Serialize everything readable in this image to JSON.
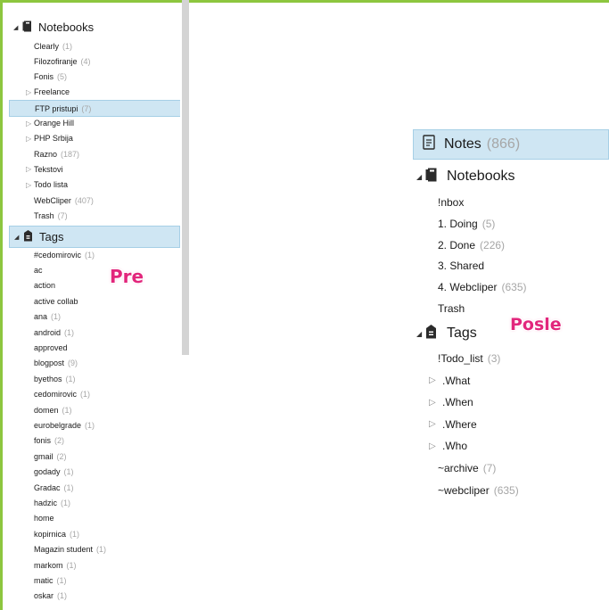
{
  "colors": {
    "accent_border": "#8dc63f",
    "selection": "#cfe6f3",
    "count": "#a6a6a6",
    "overlay_label": "#e2267c"
  },
  "before": {
    "notebooks_label": "Notebooks",
    "notebooks": [
      {
        "label": "Clearly",
        "count": "(1)",
        "expandable": false
      },
      {
        "label": "Filozofiranje",
        "count": "(4)",
        "expandable": false
      },
      {
        "label": "Fonis",
        "count": "(5)",
        "expandable": false
      },
      {
        "label": "Freelance",
        "count": "",
        "expandable": true
      },
      {
        "label": "FTP pristupi",
        "count": "(7)",
        "expandable": false,
        "selected": true
      },
      {
        "label": "Orange Hill",
        "count": "",
        "expandable": true
      },
      {
        "label": "PHP Srbija",
        "count": "",
        "expandable": true
      },
      {
        "label": "Razno",
        "count": "(187)",
        "expandable": false
      },
      {
        "label": "Tekstovi",
        "count": "",
        "expandable": true
      },
      {
        "label": "Todo lista",
        "count": "",
        "expandable": true
      },
      {
        "label": "WebCliper",
        "count": "(407)",
        "expandable": false
      },
      {
        "label": "Trash",
        "count": "(7)",
        "expandable": false
      }
    ],
    "tags_label": "Tags",
    "tags": [
      {
        "label": "#cedomirovic",
        "count": "(1)"
      },
      {
        "label": "ac",
        "count": ""
      },
      {
        "label": "action",
        "count": ""
      },
      {
        "label": "active collab",
        "count": ""
      },
      {
        "label": "ana",
        "count": "(1)"
      },
      {
        "label": "android",
        "count": "(1)"
      },
      {
        "label": "approved",
        "count": ""
      },
      {
        "label": "blogpost",
        "count": "(9)"
      },
      {
        "label": "byethos",
        "count": "(1)"
      },
      {
        "label": "cedomirovic",
        "count": "(1)"
      },
      {
        "label": "domen",
        "count": "(1)"
      },
      {
        "label": "eurobelgrade",
        "count": "(1)"
      },
      {
        "label": "fonis",
        "count": "(2)"
      },
      {
        "label": "gmail",
        "count": "(2)"
      },
      {
        "label": "godady",
        "count": "(1)"
      },
      {
        "label": "Gradac",
        "count": "(1)"
      },
      {
        "label": "hadzic",
        "count": "(1)"
      },
      {
        "label": "home",
        "count": ""
      },
      {
        "label": "kopirnica",
        "count": "(1)"
      },
      {
        "label": "Magazin student",
        "count": "(1)"
      },
      {
        "label": "markom",
        "count": "(1)"
      },
      {
        "label": "matic",
        "count": "(1)"
      },
      {
        "label": "oskar",
        "count": "(1)"
      }
    ],
    "overlay_label": "Pre"
  },
  "after": {
    "notes_label": "Notes",
    "notes_count": "(866)",
    "notebooks_label": "Notebooks",
    "notebooks": [
      {
        "label": "!nbox",
        "count": ""
      },
      {
        "label": "1. Doing",
        "count": "(5)"
      },
      {
        "label": "2. Done",
        "count": "(226)"
      },
      {
        "label": "3. Shared",
        "count": ""
      },
      {
        "label": "4. Webcliper",
        "count": "(635)"
      },
      {
        "label": "Trash",
        "count": ""
      }
    ],
    "tags_label": "Tags",
    "tags": [
      {
        "label": "!Todo_list",
        "count": "(3)",
        "expandable": false
      },
      {
        "label": ".What",
        "count": "",
        "expandable": true
      },
      {
        "label": ".When",
        "count": "",
        "expandable": true
      },
      {
        "label": ".Where",
        "count": "",
        "expandable": true
      },
      {
        "label": ".Who",
        "count": "",
        "expandable": true
      },
      {
        "label": "~archive",
        "count": "(7)",
        "expandable": false
      },
      {
        "label": "~webcliper",
        "count": "(635)",
        "expandable": false
      }
    ],
    "overlay_label": "Posle"
  }
}
